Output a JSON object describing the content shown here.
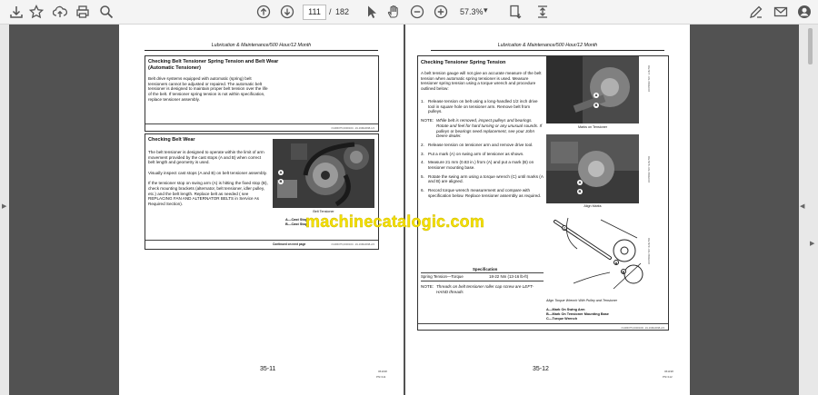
{
  "toolbar": {
    "page_current": "111",
    "page_separator": "/",
    "page_total": "182",
    "zoom": "57.3%",
    "zoom_caret": "▾",
    "icons": [
      "save-icon",
      "bookmark-star-icon",
      "upload-cloud-icon",
      "print-icon",
      "zoom-search-icon",
      "page-up-icon",
      "page-down-icon",
      "select-pointer-icon",
      "hand-pan-icon",
      "zoom-out-icon",
      "zoom-in-icon",
      "fit-page-icon",
      "scroll-mode-icon",
      "sign-pen-icon",
      "email-icon",
      "account-icon"
    ]
  },
  "watermark": "machinecatalogic.com",
  "left_page": {
    "running_head": "Lubrication & Maintenance/500 Hour/12 Month",
    "section1": {
      "title": "Checking Belt Tensioner Spring Tension and Belt Wear (Automatic Tensioner)",
      "body": "Belt drive systems equipped with automatic (spring) belt tensioners cannot be adjusted or repaired. The automatic belt tensioner is designed to maintain proper belt tension over the life of the belt. If tensioner spring tension is not within specification, replace tensioner assembly.",
      "code": "OUR6075,000016C -19-19MAR98-1/2"
    },
    "section2": {
      "title": "Checking Belt Wear",
      "body": "The belt tensioner is designed to operate within the limit of arm movement provided by the cast stops (A and B) when correct belt length and geometry is used.\n\nVisually inspect cast stops (A and B) on belt tensioner assembly.\n\nIf the tensioner stop on swing arm (A) is hitting the fixed stop (B), check mounting brackets (alternator, belt tensioner, idler pulley, etc.) and the belt length. Replace belt as needed ( see REPLACING FAN AND ALTERNATOR BELTS in Service As Required Section).",
      "photo_caption": "Belt Tensioner",
      "photo_label_a": "A",
      "photo_label_b": "B",
      "legend_a": "A—Cast Stop",
      "legend_b": "B—Cast Stop",
      "continued": "Continued on next page",
      "code": "OUR6075,000016C -19-19MAR98-2/2"
    },
    "folio": "35-11",
    "folio_code1": "061198",
    "folio_code2": "PN=111"
  },
  "right_page": {
    "running_head": "Lubrication & Maintenance/500 Hour/12 Month",
    "title": "Checking Tensioner Spring Tension",
    "intro": "A belt tension gauge will not give an accurate measure of the belt tension when automatic spring tensioner is used. Measure tensioner spring tension using a torque wrench and procedure outlined below:",
    "steps": [
      {
        "num": "1.",
        "text": "Release tension on belt using a long-handled 1/2 inch drive tool in square hole on tensioner arm. Remove belt from pulleys."
      },
      {
        "num": "NOTE:",
        "text": "While belt is removed, inspect pulleys and bearings. Rotate and feel for hard turning or any unusual sounds. If pulleys or bearings need replacement, see your John Deere dealer."
      },
      {
        "num": "2.",
        "text": "Release tension on tensioner arm and remove drive tool."
      },
      {
        "num": "3.",
        "text": "Put a mark (A) on swing arm of tensioner as shown."
      },
      {
        "num": "4.",
        "text": "Measure 21 mm (0.83 in.) from (A) and put a mark (B) on tensioner mounting base."
      },
      {
        "num": "5.",
        "text": "Rotate the swing arm using a torque wrench (C) until marks (A and B) are aligned."
      },
      {
        "num": "6.",
        "text": "Record torque wrench measurement and compare with specification below. Replace tensioner assembly as required."
      }
    ],
    "spec_heading": "Specification",
    "spec_label": "Spring Tension—Torque",
    "spec_value": "18-22 Nm (13-16 lb-ft)",
    "note2_label": "NOTE:",
    "note2": "Threads on belt tensioner roller cap screw are LEFT-HAND threads",
    "photo1_caption": "Marks on Tensioner",
    "photo2_caption": "Align Marks",
    "photo3_caption": "Align Torque Wrench With Pulley and Tensioner",
    "label_a": "A",
    "label_b": "B",
    "label_c": "C",
    "legend": [
      "A—Mark On Swing Arm",
      "B—Mark On Tensioner Mounting Base",
      "C—Torque Wrench"
    ],
    "vert_code1": "RG7977 -UN-15DEC97",
    "vert_code2": "RG7978 -UN-15DEC97",
    "vert_code3": "RG7979 -UN-15DEC97",
    "code": "OUR6075,000016D -19-19MAR98-2/2",
    "folio": "35-12",
    "folio_code1": "061198",
    "folio_code2": "PN=112"
  }
}
